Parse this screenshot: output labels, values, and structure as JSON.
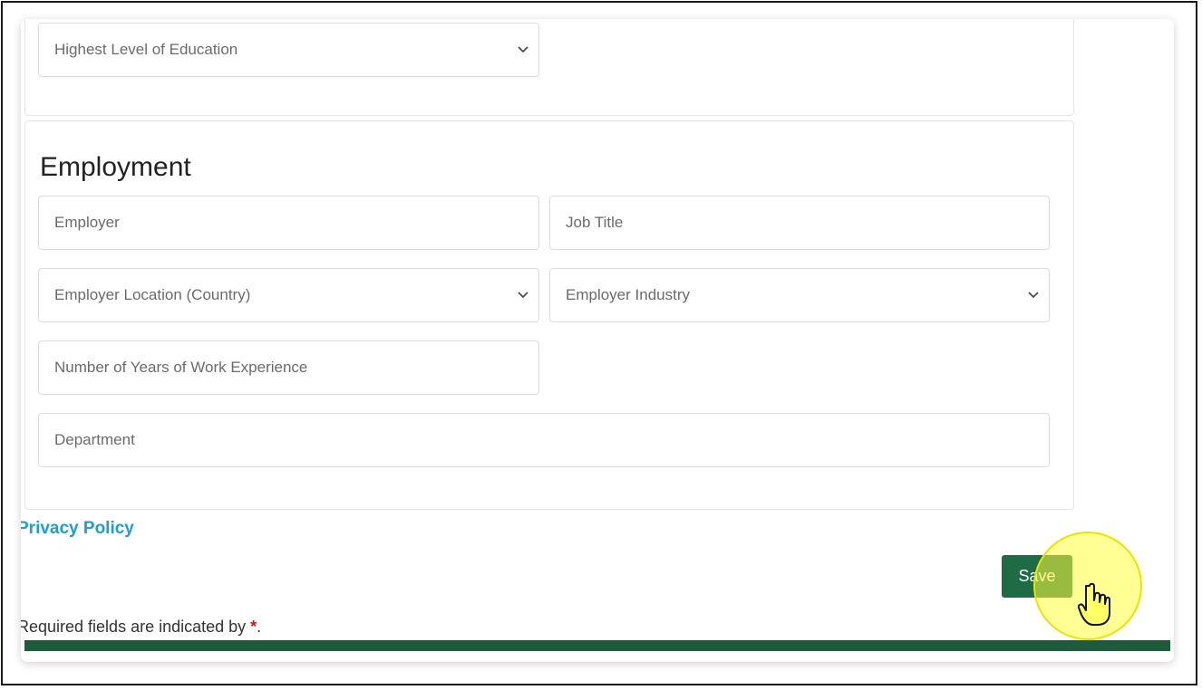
{
  "education": {
    "highest_level_placeholder": "Highest Level of Education"
  },
  "employment": {
    "heading": "Employment",
    "employer_placeholder": "Employer",
    "job_title_placeholder": "Job Title",
    "employer_location_placeholder": "Employer Location (Country)",
    "employer_industry_placeholder": "Employer Industry",
    "years_experience_placeholder": "Number of Years of Work Experience",
    "department_placeholder": "Department"
  },
  "links": {
    "privacy_policy": "Privacy Policy"
  },
  "actions": {
    "save_label": "Save"
  },
  "footer": {
    "required_text": "Required fields are indicated by ",
    "required_star": "*",
    "required_period": "."
  },
  "colors": {
    "accent_green": "#1e6b45",
    "link_blue": "#1a9fd6",
    "footer_green": "#1e5b3c",
    "required_red": "#d11111"
  },
  "icons": {
    "select_chevron": "chevron-down-icon",
    "cursor": "hand-pointer-icon"
  }
}
